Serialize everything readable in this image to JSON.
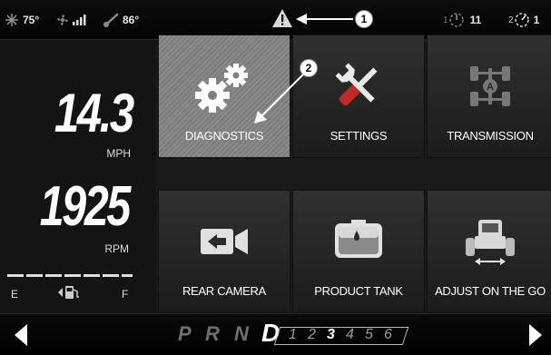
{
  "status": {
    "outside_temp": "75°",
    "engine_temp": "86°",
    "pto1_label": "1",
    "pto1_value": "11",
    "pto2_label": "2",
    "pto2_value": "1"
  },
  "callouts": [
    "1",
    "2"
  ],
  "gauges": {
    "speed": "14.3",
    "speed_unit": "MPH",
    "rpm": "1925",
    "rpm_unit": "RPM",
    "fuel_empty": "E",
    "fuel_full": "F"
  },
  "tiles": [
    {
      "label": "DIAGNOSTICS",
      "icon": "gears-icon"
    },
    {
      "label": "SETTINGS",
      "icon": "wrench-screwdriver-icon"
    },
    {
      "label": "TRANSMISSION",
      "icon": "transmission-icon"
    },
    {
      "label": "REAR CAMERA",
      "icon": "camera-icon"
    },
    {
      "label": "PRODUCT TANK",
      "icon": "tank-icon"
    },
    {
      "label": "ADJUST ON THE GO",
      "icon": "tractor-icon"
    }
  ],
  "gear_selector": {
    "gears": [
      "P",
      "R",
      "N",
      "D"
    ],
    "active_gear": "D",
    "numbers": [
      "1",
      "2",
      "3",
      "4",
      "5",
      "6"
    ],
    "active_number": "3"
  },
  "colors": {
    "active_tile": "#7f7f7f",
    "tile_bg": "#262626",
    "background": "#1a1a1a"
  }
}
